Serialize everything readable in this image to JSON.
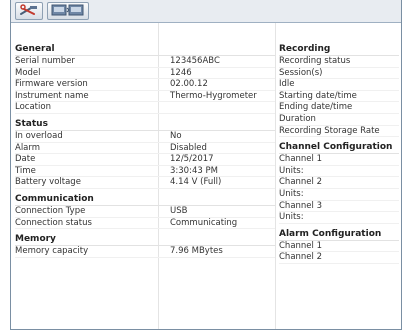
{
  "toolbar": {
    "buttons": [
      {
        "icon": "tools-icon"
      },
      {
        "icon": "instrument-display-icon"
      }
    ]
  },
  "general": {
    "title": "General",
    "rows": [
      {
        "label": "Serial number",
        "value": "123456ABC"
      },
      {
        "label": "Model",
        "value": "1246"
      },
      {
        "label": "Firmware version",
        "value": "02.00.12"
      },
      {
        "label": "Instrument name",
        "value": "Thermo-Hygrometer"
      },
      {
        "label": "Location",
        "value": ""
      }
    ]
  },
  "status": {
    "title": "Status",
    "rows": [
      {
        "label": "In overload",
        "value": "No"
      },
      {
        "label": "Alarm",
        "value": "Disabled"
      },
      {
        "label": "Date",
        "value": "12/5/2017"
      },
      {
        "label": "Time",
        "value": "3:30:43 PM"
      },
      {
        "label": "Battery voltage",
        "value": "4.14 V (Full)"
      }
    ]
  },
  "communication": {
    "title": "Communication",
    "rows": [
      {
        "label": "Connection Type",
        "value": "USB"
      },
      {
        "label": "Connection status",
        "value": "Communicating"
      }
    ]
  },
  "memory": {
    "title": "Memory",
    "rows": [
      {
        "label": "Memory capacity",
        "value": "7.96 MBytes"
      }
    ]
  },
  "recording": {
    "title": "Recording",
    "rows": [
      "Recording status",
      "Session(s)",
      "Idle",
      "Starting date/time",
      "Ending date/time",
      "Duration",
      "Recording Storage Rate"
    ]
  },
  "channel_configuration": {
    "title": "Channel Configuration",
    "rows": [
      "Channel 1",
      "Units:",
      "Channel 2",
      "Units:",
      "Channel 3",
      "Units:"
    ]
  },
  "alarm_configuration": {
    "title": "Alarm Configuration",
    "rows": [
      "Channel 1",
      "Channel 2"
    ]
  }
}
